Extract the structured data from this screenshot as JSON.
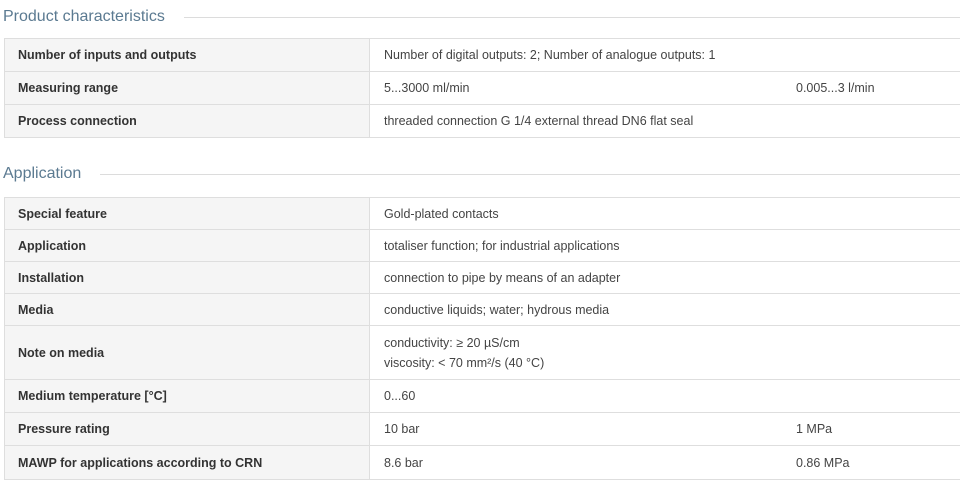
{
  "product_characteristics": {
    "title": "Product characteristics",
    "rows": [
      {
        "label": "Number of inputs and outputs",
        "value": "Number of digital outputs: 2; Number of analogue outputs: 1",
        "value2": ""
      },
      {
        "label": "Measuring range",
        "value": "5...3000 ml/min",
        "value2": "0.005...3 l/min"
      },
      {
        "label": "Process connection",
        "value": "threaded connection G 1/4 external thread DN6 flat seal",
        "value2": ""
      }
    ]
  },
  "application": {
    "title": "Application",
    "rows": [
      {
        "label": "Special feature",
        "value": "Gold-plated contacts",
        "value2": ""
      },
      {
        "label": "Application",
        "value": "totaliser function; for industrial applications",
        "value2": ""
      },
      {
        "label": "Installation",
        "value": "connection to pipe by means of an adapter",
        "value2": ""
      },
      {
        "label": "Media",
        "value": "conductive liquids; water; hydrous media",
        "value2": ""
      },
      {
        "label": "Note on media",
        "value_line1": "conductivity: ≥ 20 µS/cm",
        "value_line2": "viscosity: < 70 mm²/s (40 °C)",
        "value2": ""
      },
      {
        "label": "Medium temperature [°C]",
        "value": "0...60",
        "value2": ""
      },
      {
        "label": "Pressure rating",
        "value": "10 bar",
        "value2": "1 MPa"
      },
      {
        "label": "MAWP for applications according to CRN",
        "value": "8.6 bar",
        "value2": "0.86 MPa"
      }
    ]
  }
}
